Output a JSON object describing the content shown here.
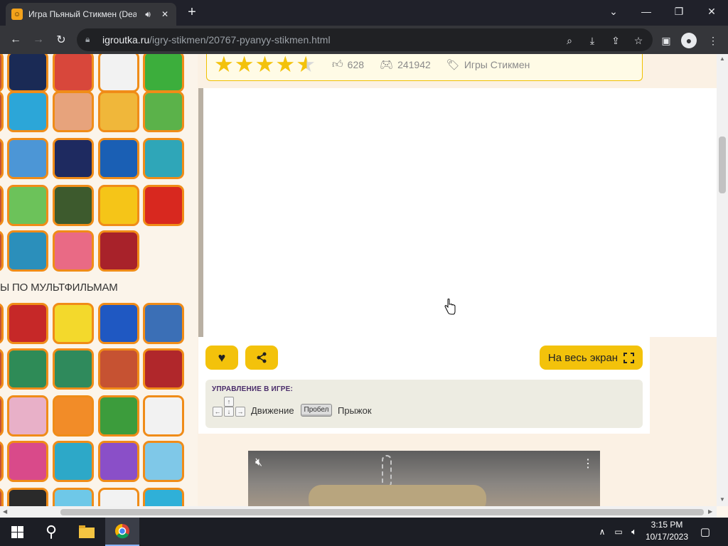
{
  "browser": {
    "tab_title": "Игра Пьяный Стикмен (Dea",
    "favicon": "game-controller-favicon",
    "url_host": "igroutka.ru",
    "url_path": "/igry-stikmen/20767-pyanyy-stikmen.html",
    "window_controls": [
      "minimize",
      "restore",
      "close"
    ],
    "tab_list_chevron": "⌄"
  },
  "page": {
    "rating": {
      "stars_filled": 4.5,
      "stars_max": 5,
      "likes": "628",
      "plays": "241942",
      "category": "Игры Стикмен"
    },
    "sidebar_section_title": "Ы ПО МУЛЬТФИЛЬМАМ",
    "sidebar_thumbnails": [
      {
        "icon": "snake-game-thumb",
        "color": "#1a2a55"
      },
      {
        "icon": "angry-birds-thumb",
        "color": "#d8473b"
      },
      {
        "icon": "panda-thumb",
        "color": "#f2f2f2"
      },
      {
        "icon": "om-nom-thumb",
        "color": "#3cae3c"
      },
      {
        "icon": "dolphin-thumb",
        "color": "#2ca6d8"
      },
      {
        "icon": "candy-thumb",
        "color": "#e7a37c"
      },
      {
        "icon": "lion-thumb",
        "color": "#f0b73a"
      },
      {
        "icon": "wheely-car-thumb",
        "color": "#5bb24a"
      },
      {
        "icon": "plane-thumb",
        "color": "#4c96d6"
      },
      {
        "icon": "cartoon-network-thumb",
        "color": "#1e2a60"
      },
      {
        "icon": "disney-channel-thumb",
        "color": "#1a5fb4"
      },
      {
        "icon": "bubbles-thumb",
        "color": "#2fa6b8"
      },
      {
        "icon": "monster-thumb",
        "color": "#6cc25a"
      },
      {
        "icon": "tank-thumb",
        "color": "#3d5a2d"
      },
      {
        "icon": "brawl-face-thumb",
        "color": "#f5c518"
      },
      {
        "icon": "among-us-thumb",
        "color": "#d8281f"
      },
      {
        "icon": "squid-game-thumb",
        "color": "#2b8fbb"
      },
      {
        "icon": "pop-it-thumb",
        "color": "#e96a85"
      },
      {
        "icon": "angry-bird-red-thumb",
        "color": "#a8222a"
      },
      {
        "icon": "spiderman-thumb",
        "color": "#c62828"
      },
      {
        "icon": "spongebob-thumb",
        "color": "#f3d92c"
      },
      {
        "icon": "sonic-thumb",
        "color": "#1f58c2"
      },
      {
        "icon": "paw-patrol-thumb",
        "color": "#3b6fb6"
      },
      {
        "icon": "ninja-thumb",
        "color": "#2e8b57"
      },
      {
        "icon": "gravity-falls-thumb",
        "color": "#2f8a5c"
      },
      {
        "icon": "tom-jerry-thumb",
        "color": "#c65232"
      },
      {
        "icon": "cars-thumb",
        "color": "#b0272b"
      },
      {
        "icon": "princess-thumb",
        "color": "#e8b0c8"
      },
      {
        "icon": "naruto-thumb",
        "color": "#f28c28"
      },
      {
        "icon": "scooby-thumb",
        "color": "#3c9c3c"
      },
      {
        "icon": "rabbids-thumb",
        "color": "#f2f2f2"
      },
      {
        "icon": "dora-thumb",
        "color": "#d94a8a"
      },
      {
        "icon": "perry-thumb",
        "color": "#2da8c8"
      },
      {
        "icon": "equestria-thumb",
        "color": "#8a4fc8"
      },
      {
        "icon": "frozen-thumb",
        "color": "#7fc8e8"
      },
      {
        "icon": "batman-thumb",
        "color": "#2a2a2a"
      },
      {
        "icon": "adventure-time-thumb",
        "color": "#6ec8e8"
      },
      {
        "icon": "teen-titans-thumb",
        "color": "#f2f2f2"
      },
      {
        "icon": "gumball-thumb",
        "color": "#2fb0d8"
      }
    ],
    "buttons": {
      "favorite_icon": "heart-icon",
      "share_icon": "share-icon",
      "fullscreen_label": "На весь экран"
    },
    "controls": {
      "header": "УПРАВЛЕНИЕ В ИГРЕ:",
      "arrow_up": "↑",
      "arrow_left": "←",
      "arrow_down": "↓",
      "arrow_right": "→",
      "move_label": "Движение",
      "space_key": "Пробел",
      "jump_label": "Прыжок"
    }
  },
  "taskbar": {
    "time": "3:15 PM",
    "date": "10/17/2023"
  }
}
